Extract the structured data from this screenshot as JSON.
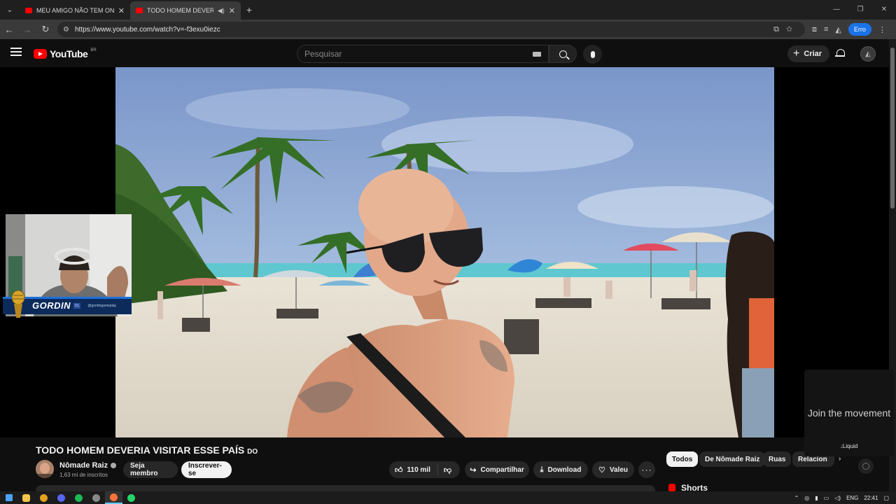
{
  "browser": {
    "tabs": [
      {
        "title": "MEU AMIGO NÃO TEM ONDE MO",
        "active": false
      },
      {
        "title": "TODO HOMEM DEVERIA VISITAR",
        "active": true
      }
    ],
    "url": "https://www.youtube.com/watch?v=-f3exu0iezc",
    "error_badge": "Erro"
  },
  "header": {
    "logo_text": "YouTube",
    "region": "BR",
    "search_placeholder": "Pesquisar",
    "create_label": "Criar"
  },
  "webcam": {
    "name": "GORDIN",
    "tag": "DL",
    "handle": "@gordingameplay"
  },
  "video": {
    "title": "TODO HOMEM DEVERIA VISITAR ESSE PAÍS",
    "title_suffix": "DO",
    "channel_name": "Nômade Raiz",
    "subscribers": "1,63 mi de inscritos",
    "join_label": "Seja membro",
    "subscribe_label": "Inscrever-se",
    "likes": "110 mil",
    "share_label": "Compartilhar",
    "download_label": "Download",
    "thanks_label": "Valeu"
  },
  "chips": [
    "Todos",
    "De Nômade Raiz",
    "Ruas",
    "Relacion"
  ],
  "shorts_label": "Shorts",
  "ad": {
    "headline": "Join the movement",
    "brand": "Liquid"
  },
  "taskbar": {
    "lang": "ENG",
    "time": "22:41"
  },
  "colors": {
    "accent_red": "#ff0000",
    "page_bg": "#0f0f0f",
    "chip_bg": "#272727",
    "error_badge": "#1a73e8"
  }
}
